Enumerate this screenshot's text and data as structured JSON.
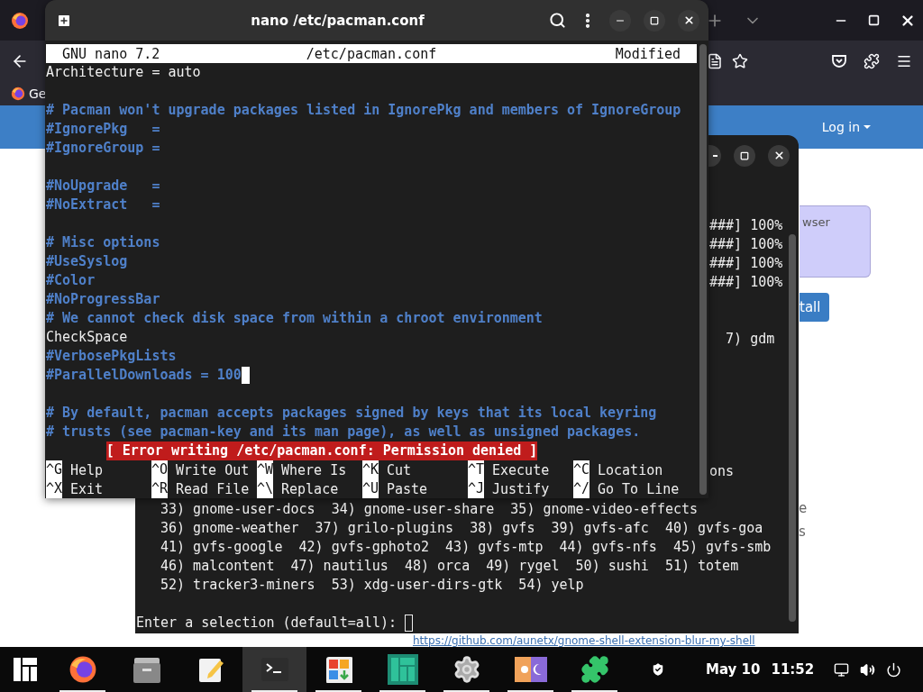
{
  "browser": {
    "bookmark": "Ge",
    "login": "Log in",
    "panel_text": "wser",
    "install_button": "tall",
    "fragments": [
      "e",
      "s"
    ],
    "link": "https://github.com/aunetx/gnome-shell-extension-blur-my-shell"
  },
  "terminal": {
    "lines": [
      {
        "kind": "tail",
        "text": "###] 100%"
      },
      {
        "kind": "tail",
        "text": "###] 100%"
      },
      {
        "kind": "tail",
        "text": "###] 100%"
      },
      {
        "kind": "tail",
        "text": "###] 100%"
      },
      {
        "kind": "blank"
      },
      {
        "kind": "blank"
      },
      {
        "kind": "tail",
        "text": "  7) gdm"
      },
      {
        "kind": "blank"
      },
      {
        "kind": "blank"
      },
      {
        "kind": "blank"
      },
      {
        "kind": "blank"
      },
      {
        "kind": "blank"
      },
      {
        "kind": "blank"
      },
      {
        "kind": "tail",
        "text": "ons"
      },
      {
        "kind": "blank"
      },
      {
        "kind": "list",
        "text": "33) gnome-user-docs  34) gnome-user-share  35) gnome-video-effects"
      },
      {
        "kind": "list",
        "text": "36) gnome-weather  37) grilo-plugins  38) gvfs  39) gvfs-afc  40) gvfs-goa"
      },
      {
        "kind": "list",
        "text": "41) gvfs-google  42) gvfs-gphoto2  43) gvfs-mtp  44) gvfs-nfs  45) gvfs-smb"
      },
      {
        "kind": "list",
        "text": "46) malcontent  47) nautilus  48) orca  49) rygel  50) sushi  51) totem"
      },
      {
        "kind": "list",
        "text": "52) tracker3-miners  53) xdg-user-dirs-gtk  54) yelp"
      },
      {
        "kind": "blank"
      },
      {
        "kind": "prompt",
        "text": "Enter a selection (default=all):"
      }
    ]
  },
  "nano": {
    "title": "nano /etc/pacman.conf",
    "version": "GNU nano 7.2",
    "file": "/etc/pacman.conf",
    "state": "Modified",
    "lines": [
      {
        "kind": "setting",
        "text": "Architecture = auto",
        "cursor": false
      },
      {
        "kind": "blank",
        "cursor": false
      },
      {
        "kind": "comment",
        "text": "# Pacman won't upgrade packages listed in IgnorePkg and members of IgnoreGroup",
        "cursor": false
      },
      {
        "kind": "comment",
        "text": "#IgnorePkg   =",
        "cursor": false
      },
      {
        "kind": "comment",
        "text": "#IgnoreGroup =",
        "cursor": false
      },
      {
        "kind": "blank",
        "cursor": false
      },
      {
        "kind": "comment",
        "text": "#NoUpgrade   =",
        "cursor": false
      },
      {
        "kind": "comment",
        "text": "#NoExtract   =",
        "cursor": false
      },
      {
        "kind": "blank",
        "cursor": false
      },
      {
        "kind": "comment",
        "text": "# Misc options",
        "cursor": false
      },
      {
        "kind": "comment",
        "text": "#UseSyslog",
        "cursor": false
      },
      {
        "kind": "comment",
        "text": "#Color",
        "cursor": false
      },
      {
        "kind": "comment",
        "text": "#NoProgressBar",
        "cursor": false
      },
      {
        "kind": "comment",
        "text": "# We cannot check disk space from within a chroot environment",
        "cursor": false
      },
      {
        "kind": "setting",
        "text": "CheckSpace",
        "cursor": false
      },
      {
        "kind": "comment",
        "text": "#VerbosePkgLists",
        "cursor": false
      },
      {
        "kind": "comment",
        "text": "#ParallelDownloads = 100",
        "cursor": true
      },
      {
        "kind": "blank",
        "cursor": false
      },
      {
        "kind": "comment",
        "text": "# By default, pacman accepts packages signed by keys that its local keyring",
        "cursor": false
      },
      {
        "kind": "comment",
        "text": "# trusts (see pacman-key and its man page), as well as unsigned packages.",
        "cursor": false
      }
    ],
    "status": "[ Error writing /etc/pacman.conf: Permission denied ]",
    "shortcuts": [
      [
        {
          "key": "^G",
          "label": "Help"
        },
        {
          "key": "^O",
          "label": "Write Out"
        },
        {
          "key": "^W",
          "label": "Where Is"
        },
        {
          "key": "^K",
          "label": "Cut"
        },
        {
          "key": "^T",
          "label": "Execute"
        },
        {
          "key": "^C",
          "label": "Location"
        }
      ],
      [
        {
          "key": "^X",
          "label": "Exit"
        },
        {
          "key": "^R",
          "label": "Read File"
        },
        {
          "key": "^\\",
          "label": "Replace"
        },
        {
          "key": "^U",
          "label": "Paste"
        },
        {
          "key": "^J",
          "label": "Justify"
        },
        {
          "key": "^/",
          "label": "Go To Line"
        }
      ]
    ]
  },
  "taskbar": {
    "apps": [
      {
        "kind": "menu",
        "running": false,
        "selected": false
      },
      {
        "kind": "firefox",
        "running": true,
        "selected": false
      },
      {
        "kind": "files",
        "running": false,
        "selected": false
      },
      {
        "kind": "notes",
        "running": false,
        "selected": false
      },
      {
        "kind": "terminal",
        "running": true,
        "selected": true
      },
      {
        "kind": "software",
        "running": true,
        "selected": false
      },
      {
        "kind": "manjaro",
        "running": true,
        "selected": false
      },
      {
        "kind": "settings",
        "running": true,
        "selected": false
      },
      {
        "kind": "theme",
        "running": true,
        "selected": false
      },
      {
        "kind": "extensions",
        "running": true,
        "selected": false
      },
      {
        "kind": "shield",
        "running": false,
        "selected": false
      }
    ],
    "date": "May 10",
    "time": "11:52"
  }
}
